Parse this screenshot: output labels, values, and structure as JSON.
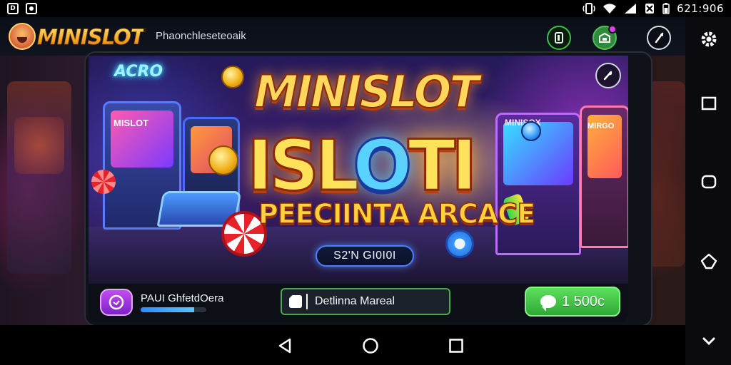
{
  "status_bar": {
    "left_icons": [
      "D",
      "notification-icon"
    ],
    "time": "621:906",
    "right_icons": [
      "vibrate-icon",
      "wifi-icon",
      "signal-icon",
      "no-sim-icon",
      "battery-icon"
    ]
  },
  "header": {
    "logo_text": "MINISLOT",
    "subtitle": "Phaonchleseteoaik",
    "buttons": [
      "help-icon",
      "wallet-icon",
      "close-icon"
    ]
  },
  "banner": {
    "title_line1": "MINISLOT",
    "title_line2_a": "ISL",
    "title_line2_o": "O",
    "title_line2_b": "TI",
    "title_line3": "PEECIINTA ARCACE",
    "pill_text": "S2'N GI0I0I",
    "neon_left": "ACRO",
    "neon_right": "MINISOX",
    "machine_left": "MISLOT",
    "machine_right": "MIRGO"
  },
  "card_footer": {
    "player_name": "PAUI GhfetdOera",
    "progress": 0.82,
    "mode_text": "Detlinna Mareal",
    "balance": "1 500c"
  },
  "colors": {
    "accent_green": "#2ea836",
    "logo_gold": "#f5a623",
    "brand_purple": "#7b22c8"
  },
  "side_toolbar": [
    "settings-icon",
    "square-icon",
    "rounded-square-icon",
    "diamond-icon",
    "chevron-down-icon"
  ],
  "nav_bar": [
    "back-icon",
    "home-icon",
    "recents-icon"
  ]
}
